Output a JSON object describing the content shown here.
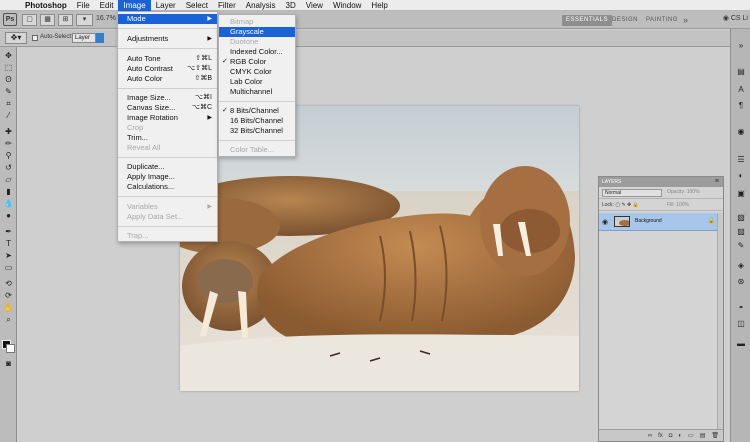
{
  "menubar": {
    "app_name": "Photoshop",
    "items": [
      "File",
      "Edit",
      "Image",
      "Layer",
      "Select",
      "Filter",
      "Analysis",
      "3D",
      "View",
      "Window",
      "Help"
    ],
    "active": "Image"
  },
  "appbar": {
    "zoom": "16.7%",
    "workspaces": [
      "ESSENTIALS",
      "DESIGN",
      "PAINTING"
    ],
    "active_workspace": "ESSENTIALS",
    "more": "»",
    "cs_live": "CS Li"
  },
  "options": {
    "auto_select_label": "Auto-Select:",
    "auto_select_value": "Layer"
  },
  "image_menu": {
    "mode": "Mode",
    "adjustments": "Adjustments",
    "auto_tone": "Auto Tone",
    "auto_tone_sc": "⇧⌘L",
    "auto_contrast": "Auto Contrast",
    "auto_contrast_sc": "⌥⇧⌘L",
    "auto_color": "Auto Color",
    "auto_color_sc": "⇧⌘B",
    "image_size": "Image Size...",
    "image_size_sc": "⌥⌘I",
    "canvas_size": "Canvas Size...",
    "canvas_size_sc": "⌥⌘C",
    "image_rotation": "Image Rotation",
    "crop": "Crop",
    "trim": "Trim...",
    "reveal_all": "Reveal All",
    "duplicate": "Duplicate...",
    "apply_image": "Apply Image...",
    "calculations": "Calculations...",
    "variables": "Variables",
    "apply_data_set": "Apply Data Set...",
    "trap": "Trap..."
  },
  "mode_menu": {
    "bitmap": "Bitmap",
    "grayscale": "Grayscale",
    "duotone": "Duotone",
    "indexed_color": "Indexed Color...",
    "rgb_color": "RGB Color",
    "cmyk_color": "CMYK Color",
    "lab_color": "Lab Color",
    "multichannel": "Multichannel",
    "bits8": "8 Bits/Channel",
    "bits16": "16 Bits/Channel",
    "bits32": "32 Bits/Channel",
    "color_table": "Color Table...",
    "checked_mode": "RGB Color",
    "checked_bits": "8 Bits/Channel"
  },
  "layers_panel": {
    "title": "LAYERS",
    "blend_mode": "Normal",
    "opacity_label": "Opacity:",
    "opacity_value": "100%",
    "lock_label": "Lock:",
    "fill_label": "Fill:",
    "fill_value": "100%",
    "layer_name": "Background"
  },
  "colors": {
    "menu_highlight": "#1a63d6",
    "layer_selected": "#a8c6ea"
  }
}
